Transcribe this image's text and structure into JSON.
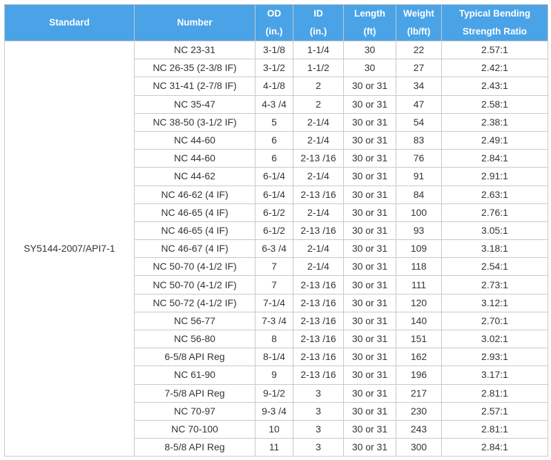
{
  "headers": {
    "standard": "Standard",
    "number": "Number",
    "od": [
      "OD",
      "(in.)"
    ],
    "id": [
      "ID",
      "(in.)"
    ],
    "length": [
      "Length",
      "(ft)"
    ],
    "weight": [
      "Weight",
      "(lb/ft)"
    ],
    "ratio": [
      "Typical Bending",
      "Strength Ratio"
    ]
  },
  "standard_value": "SY5144-2007/API7-1",
  "rows": [
    {
      "number": "NC 23-31",
      "od": "3-1/8",
      "id": "1-1/4",
      "length": "30",
      "weight": "22",
      "ratio": "2.57:1"
    },
    {
      "number": "NC 26-35 (2-3/8 IF)",
      "od": "3-1/2",
      "id": "1-1/2",
      "length": "30",
      "weight": "27",
      "ratio": "2.42:1"
    },
    {
      "number": "NC 31-41 (2-7/8 IF)",
      "od": "4-1/8",
      "id": "2",
      "length": "30 or 31",
      "weight": "34",
      "ratio": "2.43:1"
    },
    {
      "number": "NC 35-47",
      "od": "4-3 /4",
      "id": "2",
      "length": "30 or 31",
      "weight": "47",
      "ratio": "2.58:1"
    },
    {
      "number": "NC 38-50 (3-1/2 IF)",
      "od": "5",
      "id": "2-1/4",
      "length": "30 or 31",
      "weight": "54",
      "ratio": "2.38:1"
    },
    {
      "number": "NC 44-60",
      "od": "6",
      "id": "2-1/4",
      "length": "30 or 31",
      "weight": "83",
      "ratio": "2.49:1"
    },
    {
      "number": "NC 44-60",
      "od": "6",
      "id": "2-13 /16",
      "length": "30 or 31",
      "weight": "76",
      "ratio": "2.84:1"
    },
    {
      "number": "NC 44-62",
      "od": "6-1/4",
      "id": "2-1/4",
      "length": "30 or 31",
      "weight": "91",
      "ratio": "2.91:1"
    },
    {
      "number": "NC 46-62 (4 IF)",
      "od": "6-1/4",
      "id": "2-13 /16",
      "length": "30 or 31",
      "weight": "84",
      "ratio": "2.63:1"
    },
    {
      "number": "NC 46-65 (4 IF)",
      "od": "6-1/2",
      "id": "2-1/4",
      "length": "30 or 31",
      "weight": "100",
      "ratio": "2.76:1"
    },
    {
      "number": "NC 46-65 (4 IF)",
      "od": "6-1/2",
      "id": "2-13 /16",
      "length": "30 or 31",
      "weight": "93",
      "ratio": "3.05:1"
    },
    {
      "number": "NC 46-67 (4 IF)",
      "od": "6-3 /4",
      "id": "2-1/4",
      "length": "30 or 31",
      "weight": "109",
      "ratio": "3.18:1"
    },
    {
      "number": "NC 50-70 (4-1/2 IF)",
      "od": "7",
      "id": "2-1/4",
      "length": "30 or 31",
      "weight": "118",
      "ratio": "2.54:1"
    },
    {
      "number": "NC 50-70 (4-1/2 IF)",
      "od": "7",
      "id": "2-13 /16",
      "length": "30 or 31",
      "weight": "111",
      "ratio": "2.73:1"
    },
    {
      "number": "NC 50-72 (4-1/2 IF)",
      "od": "7-1/4",
      "id": "2-13 /16",
      "length": "30 or 31",
      "weight": "120",
      "ratio": "3.12:1"
    },
    {
      "number": "NC 56-77",
      "od": "7-3 /4",
      "id": "2-13 /16",
      "length": "30 or 31",
      "weight": "140",
      "ratio": "2.70:1"
    },
    {
      "number": "NC 56-80",
      "od": "8",
      "id": "2-13 /16",
      "length": "30 or 31",
      "weight": "151",
      "ratio": "3.02:1"
    },
    {
      "number": "6-5/8 API Reg",
      "od": "8-1/4",
      "id": "2-13 /16",
      "length": "30 or 31",
      "weight": "162",
      "ratio": "2.93:1"
    },
    {
      "number": "NC 61-90",
      "od": "9",
      "id": "2-13 /16",
      "length": "30 or 31",
      "weight": "196",
      "ratio": "3.17:1"
    },
    {
      "number": "7-5/8 API Reg",
      "od": "9-1/2",
      "id": "3",
      "length": "30 or 31",
      "weight": "217",
      "ratio": "2.81:1"
    },
    {
      "number": "NC 70-97",
      "od": "9-3 /4",
      "id": "3",
      "length": "30 or 31",
      "weight": "230",
      "ratio": "2.57:1"
    },
    {
      "number": "NC 70-100",
      "od": "10",
      "id": "3",
      "length": "30 or 31",
      "weight": "243",
      "ratio": "2.81:1"
    },
    {
      "number": "8-5/8 API Reg",
      "od": "11",
      "id": "3",
      "length": "30 or 31",
      "weight": "300",
      "ratio": "2.84:1"
    }
  ],
  "colors": {
    "header_bg": "#4aa3e6",
    "header_text": "#ffffff",
    "border": "#c8c8c8",
    "body_text": "#333333"
  }
}
